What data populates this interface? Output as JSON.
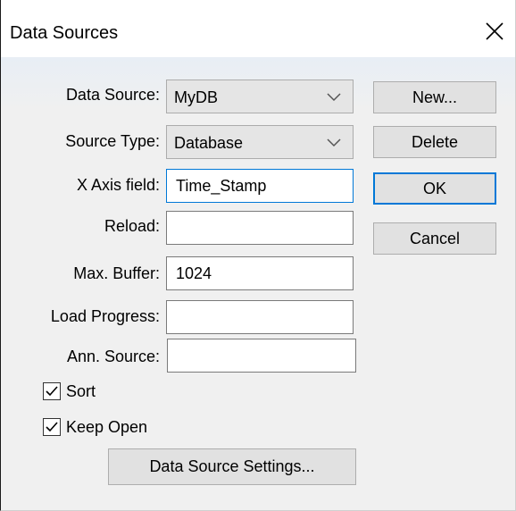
{
  "window": {
    "title": "Data Sources",
    "close_icon": "close-icon"
  },
  "form": {
    "data_source": {
      "label": "Data Source:",
      "value": "MyDB",
      "icon": "chevron-down-icon"
    },
    "source_type": {
      "label": "Source Type:",
      "value": "Database",
      "icon": "chevron-down-icon"
    },
    "x_axis_field": {
      "label": "X Axis field:",
      "value": "Time_Stamp"
    },
    "reload": {
      "label": "Reload:",
      "value": ""
    },
    "max_buffer": {
      "label": "Max. Buffer:",
      "value": "1024"
    },
    "load_progress": {
      "label": "Load Progress:",
      "value": ""
    },
    "ann_source": {
      "label": "Ann. Source:",
      "value": ""
    },
    "sort": {
      "label": "Sort",
      "checked": true,
      "icon": "checkmark-icon"
    },
    "keep_open": {
      "label": "Keep Open",
      "checked": true,
      "icon": "checkmark-icon"
    }
  },
  "buttons": {
    "new_label": "New...",
    "delete_label": "Delete",
    "ok_label": "OK",
    "cancel_label": "Cancel",
    "settings_label": "Data Source Settings..."
  },
  "colors": {
    "focus_border": "#0078d7",
    "client_background": "#f0f0f0",
    "button_face": "#e1e1e1"
  }
}
